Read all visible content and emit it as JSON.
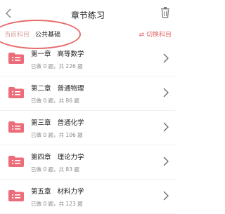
{
  "header": {
    "title": "章节练习"
  },
  "subject": {
    "current_label": "当前科目",
    "current_value": "公共基础",
    "switch_label": "⇄ 切换科目"
  },
  "chapters": [
    {
      "title": "第一章   高等数学",
      "progress": "已做 0 题，共 226 题"
    },
    {
      "title": "第二章   普通物理",
      "progress": "已做 0 题，共 86 题"
    },
    {
      "title": "第三章   普通化学",
      "progress": "已做 0 题，共 106 题"
    },
    {
      "title": "第四章   理论力学",
      "progress": "已做 0 题，共 83 题"
    },
    {
      "title": "第五章   材料力学",
      "progress": "已做 0 题，共 123 题"
    }
  ],
  "colors": {
    "accent": "#e86c6c",
    "folder": "#ec6d79"
  }
}
